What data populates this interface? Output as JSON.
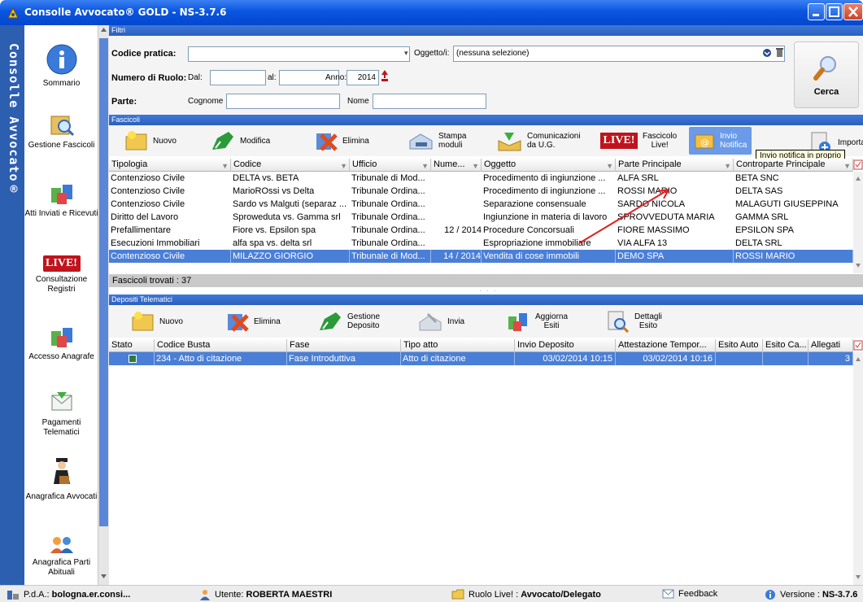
{
  "window": {
    "title": "Consolle Avvocato® GOLD - NS-3.7.6"
  },
  "sidebar": {
    "vertical_title": "Consolle Avvocato®",
    "items": [
      {
        "label": "Sommario"
      },
      {
        "label": "Gestione Fascicoli"
      },
      {
        "label": "Atti Inviati e Ricevuti"
      },
      {
        "label": "Consultazione Registri",
        "badge": "LIVE!"
      },
      {
        "label": "Accesso Anagrafe"
      },
      {
        "label": "Pagamenti Telematici"
      },
      {
        "label": "Anagrafica Avvocati"
      },
      {
        "label": "Anagrafica Parti Abituali"
      }
    ]
  },
  "filters": {
    "header": "Filtri",
    "codice_pratica_label": "Codice pratica:",
    "codice_pratica_value": "",
    "oggetto_label": "Oggetto/i:",
    "oggetto_value": "(nessuna selezione)",
    "numero_ruolo_label": "Numero di Ruolo:",
    "dal_label": "Dal:",
    "al_label": "al:",
    "anno_label": "Anno:",
    "anno_value": "2014",
    "parte_label": "Parte:",
    "cognome_label": "Cognome",
    "nome_label": "Nome",
    "cerca_label": "Cerca"
  },
  "fascicoli": {
    "header": "Fascicoli",
    "toolbar": {
      "nuovo": "Nuovo",
      "modifica": "Modifica",
      "elimina": "Elimina",
      "stampa_1": "Stampa",
      "stampa_2": "moduli",
      "comunicazioni_1": "Comunicazioni",
      "comunicazioni_2": "da U.G.",
      "live_badge": "LIVE!",
      "fascicolo_1": "Fascicolo",
      "fascicolo_2": "Live!",
      "invio_1": "Invio",
      "invio_2": "Notifica",
      "importa": "Importa"
    },
    "tooltip": "Invio notifica in proprio",
    "columns": [
      "Tipologia",
      "Codice",
      "Ufficio",
      "Nume...",
      "Oggetto",
      "Parte Principale",
      "Controparte Principale"
    ],
    "rows": [
      [
        "Contenzioso Civile",
        "DELTA vs. BETA",
        "Tribunale di Mod...",
        "",
        "Procedimento di ingiunzione ...",
        "ALFA SRL",
        "BETA SNC"
      ],
      [
        "Contenzioso Civile",
        "MarioROssi vs Delta",
        "Tribunale Ordina...",
        "",
        "Procedimento di ingiunzione ...",
        "ROSSI MARIO",
        "DELTA SAS"
      ],
      [
        "Contenzioso Civile",
        "Sardo vs Malguti (separaz ...",
        "Tribunale Ordina...",
        "",
        "Separazione consensuale",
        "SARDO NICOLA",
        "MALAGUTI GIUSEPPINA"
      ],
      [
        "Diritto del Lavoro",
        "Sproweduta vs. Gamma srl",
        "Tribunale Ordina...",
        "",
        "Ingiunzione in materia di lavoro",
        "SPROVVEDUTA MARIA",
        "GAMMA SRL"
      ],
      [
        "Prefallimentare",
        "Fiore vs. Epsilon spa",
        "Tribunale Ordina...",
        "12 / 2014",
        "Procedure Concorsuali",
        "FIORE MASSIMO",
        "EPSILON SPA"
      ],
      [
        "Esecuzioni Immobiliari",
        "alfa spa vs. delta srl",
        "Tribunale Ordina...",
        "",
        "Espropriazione immobiliare",
        "VIA ALFA 13",
        "DELTA SRL"
      ],
      [
        "Contenzioso Civile",
        "MILAZZO GIORGIO",
        "Tribunale di Mod...",
        "14 / 2014",
        "Vendita di cose immobili",
        "DEMO SPA",
        "ROSSI MARIO"
      ]
    ],
    "selected_row": 6,
    "found_label": "Fascicoli trovati : 37"
  },
  "depositi": {
    "header": "Depositi Telematici",
    "toolbar": {
      "nuovo": "Nuovo",
      "elimina": "Elimina",
      "gestione_1": "Gestione",
      "gestione_2": "Deposito",
      "invia": "Invia",
      "aggiorna_1": "Aggiorna",
      "aggiorna_2": "Esiti",
      "dettagli_1": "Dettagli",
      "dettagli_2": "Esito"
    },
    "columns": [
      "Stato",
      "Codice Busta",
      "Fase",
      "Tipo atto",
      "Invio Deposito",
      "Attestazione Tempor...",
      "Esito Auto",
      "Esito Ca...",
      "Allegati"
    ],
    "rows": [
      [
        "",
        "234 - Atto di citazione",
        "Fase Introduttiva",
        "Atto di citazione",
        "03/02/2014 10:15",
        "03/02/2014 10:16",
        "",
        "",
        "3"
      ]
    ]
  },
  "statusbar": {
    "pda_label": "P.d.A.:",
    "pda_value": "bologna.er.consi...",
    "utente_label": "Utente:",
    "utente_value": "ROBERTA MAESTRI",
    "ruolo_label": "Ruolo Live! :",
    "ruolo_value": "Avvocato/Delegato",
    "feedback": "Feedback",
    "versione_label": "Versione :",
    "versione_value": "NS-3.7.6"
  },
  "colors": {
    "title_blue": "#0a55e0",
    "header_blue": "#2b5fc0",
    "selection": "#4a7fd8",
    "live_red": "#c0141c"
  }
}
